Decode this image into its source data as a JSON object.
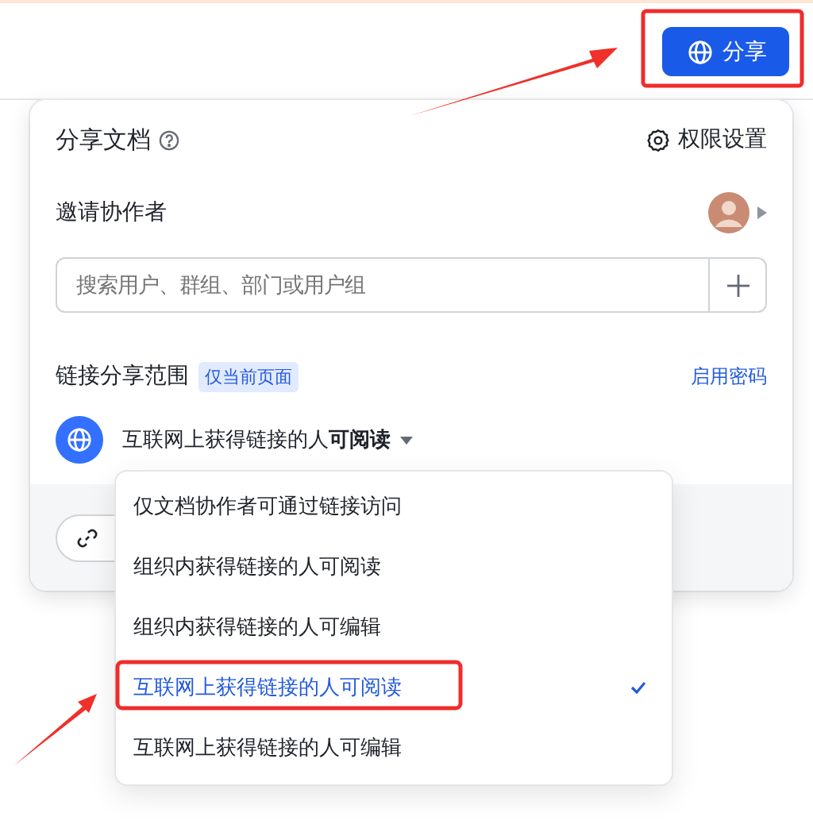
{
  "top_bar": {
    "share_button": {
      "label": "分享"
    }
  },
  "panel": {
    "title": "分享文档",
    "permission_settings": "权限设置",
    "invite_label": "邀请协作者",
    "search": {
      "placeholder": "搜索用户、群组、部门或用户组"
    },
    "link_scope_label": "链接分享范围",
    "scope_tag": "仅当前页面",
    "enable_password": "启用密码",
    "link_permission": "互联网上获得链接的人**可阅读**"
  },
  "dropdown": {
    "options": [
      {
        "label": "仅文档协作者可通过链接访问",
        "selected": false
      },
      {
        "label": "组织内获得链接的人可阅读",
        "selected": false
      },
      {
        "label": "组织内获得链接的人可编辑",
        "selected": false
      },
      {
        "label": "互联网上获得链接的人可阅读",
        "selected": true
      },
      {
        "label": "互联网上获得链接的人可编辑",
        "selected": false
      }
    ]
  }
}
